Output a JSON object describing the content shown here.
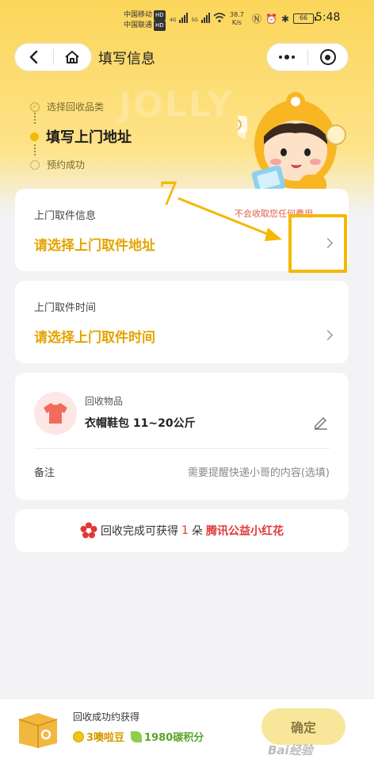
{
  "status_bar": {
    "carrier1": "中国移动",
    "carrier2": "中国联通",
    "hd_badge": "HD",
    "net_4g": "4G",
    "net_5g": "5G",
    "net_speed_value": "38.7",
    "net_speed_unit": "K/s",
    "battery": "66",
    "time": "5:48"
  },
  "nav": {
    "title": "填写信息"
  },
  "steps": [
    {
      "label": "选择回收品类",
      "state": "done"
    },
    {
      "label": "填写上门地址",
      "state": "active"
    },
    {
      "label": "预约成功",
      "state": "pending"
    }
  ],
  "hero": {
    "watermark": "JOLLY"
  },
  "pickup_info": {
    "label": "上门取件信息",
    "fee_note": "不会收取您任何费用",
    "value": "请选择上门取件地址"
  },
  "pickup_time": {
    "label": "上门取件时间",
    "value": "请选择上门取件时间"
  },
  "item": {
    "type_label": "回收物品",
    "desc": "衣帽鞋包  11~20公斤",
    "note_label": "备注",
    "note_placeholder": "需要提醒快递小哥的内容(选填)"
  },
  "reward_banner": {
    "prefix": "回收完成可获得",
    "count": "1",
    "unit": "朵",
    "link": "腾讯公益小红花"
  },
  "annotation": {
    "number": "7"
  },
  "bottom_bar": {
    "title": "回收成功约获得",
    "beans": "3噢啦豆",
    "points": "1980碳积分",
    "confirm": "确定"
  },
  "watermark": "Bai经验",
  "colors": {
    "accent": "#f5b800",
    "highlight_text": "#e4a400",
    "red": "#e23636"
  }
}
